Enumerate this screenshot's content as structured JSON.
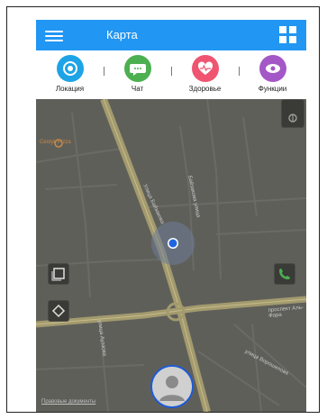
{
  "app": {
    "title": "Карта"
  },
  "tabs": [
    {
      "label": "Локация",
      "color": "#1ea3e6",
      "icon": "location-icon"
    },
    {
      "label": "Чат",
      "color": "#4caf50",
      "icon": "chat-icon"
    },
    {
      "label": "Здоровье",
      "color": "#ef5570",
      "icon": "heart-icon"
    },
    {
      "label": "Функции",
      "color": "#a457c6",
      "icon": "functions-icon"
    }
  ],
  "map": {
    "poi_name": "Cestyk Pizza",
    "road_label_main": "проспект Аль-Фара",
    "road_label_a": "Улица Байзакова",
    "road_label_b": "Байзакова улица",
    "road_label_c": "улица Ауэзова",
    "road_label_d": "улица Ворошилова",
    "legal_link": "Правовые документы"
  },
  "colors": {
    "topbar": "#2196f3",
    "map_background": "#5f5f5a",
    "main_road": "#a39a6e",
    "location_dot": "#1e66e0",
    "avatar_ring": "#1e5bd6",
    "phone": "#4caf50"
  }
}
